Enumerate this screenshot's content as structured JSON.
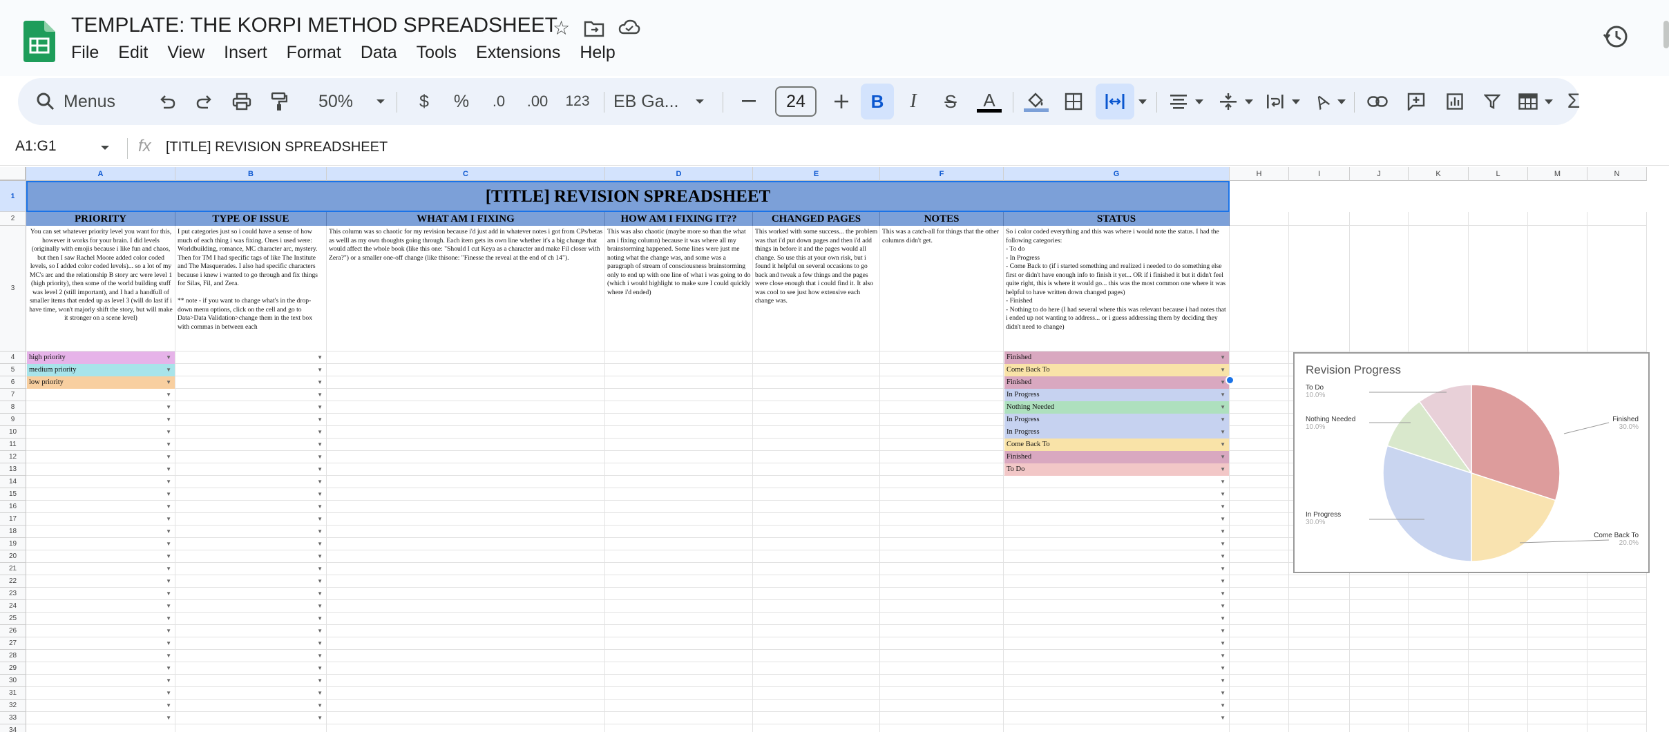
{
  "doc": {
    "title": "TEMPLATE: THE KORPI METHOD SPREADSHEET"
  },
  "menu": [
    "File",
    "Edit",
    "View",
    "Insert",
    "Format",
    "Data",
    "Tools",
    "Extensions",
    "Help"
  ],
  "toolbar": {
    "menus_label": "Menus",
    "zoom": "50%",
    "currency": "$",
    "percent": "%",
    "dec_decrease": ".0",
    "dec_increase": ".00",
    "number_format": "123",
    "font": "EB Ga...",
    "font_size": "24"
  },
  "formula_bar": {
    "range": "A1:G1",
    "fx": "fx",
    "content": "[TITLE] REVISION SPREADSHEET"
  },
  "columns": [
    "A",
    "B",
    "C",
    "D",
    "E",
    "F",
    "G",
    "H",
    "I",
    "J",
    "K",
    "L",
    "M",
    "N"
  ],
  "sheet": {
    "title": "[TITLE] REVISION SPREADSHEET",
    "headers": [
      "PRIORITY",
      "TYPE OF ISSUE",
      "WHAT AM I FIXING",
      "HOW AM I FIXING IT??",
      "CHANGED PAGES",
      "NOTES",
      "STATUS"
    ],
    "descriptions": [
      "You can set whatever priority level you want for this, however it works for your brain. I did levels (originally with emojis because i like fun and chaos, but then I saw Rachel Moore added color coded levels, so I added color coded levels)... so a lot of my MC's arc and the relationship B story arc were level 1 (high priority), then some of the world building stuff was level 2 (still important), and I had a handfull of smaller items that ended up as level 3 (will do last if i have time, won't majorly shift the story, but will make it stronger on a scene level)",
      "I put categories just so i could have a sense of how much of each thing i was fixing. Ones i used were: Worldbuilding, romance, MC character arc, mystery. Then for TM I had specific tags of like The Institute and The Masquerades. I also had specific characters because i knew i wanted to go through and fix things for Silas, Fil, and Zera.\n\n** note - if you want to change what's in the drop-down menu options, click on the cell and go to Data>Data Validation>change them in the text box with commas in between each",
      "This column was so chaotic for my revision because i'd just add in whatever notes i got from CPs/betas as welll as my own thoughts going through. Each item gets its own line whether it's a big change that would affect the whole book (like this one: \"Should I cut Keya as a character and make Fil closer with Zera?\") or a smaller one-off change (like thisone: \"Finesse the reveal at the end of ch 14\").",
      "This was also chaotic (maybe more so than the what am i fixing column) because it was where all my brainstorming happened. Some lines were just me noting what the change was, and some was a paragraph of stream of consciousness brainstorming only to end up with one line of what i was going to do (which i would highlight to make sure I could quickly where i'd ended)",
      "This worked with some success... the problem was that i'd put down pages and then i'd add things in before it and the pages would all change. So use this at your own risk, but i found it helpful on several occasions to go back and tweak a few things and the pages were close enough that i could find it. It also was cool to see just how extensive each change was.",
      "This was a catch-all for things that the other columns didn't get.",
      "So i color coded everything and this was where i would note the status. I had the following categories:\n- To do\n- In Progress\n- Come Back to (if i started something and realized i needed to do something else first or didn't have enough info to finish it yet... OR if i finished it but it didn't feel quite right, this is where it would go... this was the most common one where it was helpful to have written down changed pages)\n- Finished\n- Nothing to do here (I had several where this was relevant because i had notes that i ended up not wanting to address... or i guess addressing them by deciding they didn't need to change)"
    ],
    "priority_values": [
      "high priority",
      "medium priority",
      "low priority"
    ],
    "status_values": [
      "Finished",
      "Come Back To",
      "Finished",
      "In Progress",
      "Nothing Needed",
      "In Progress",
      "In Progress",
      "Come Back To",
      "Finished",
      "To Do"
    ]
  },
  "colors": {
    "header_blue": "#7ca0d8",
    "high_priority": "#e6b3e9",
    "medium_priority": "#a8e4ea",
    "low_priority": "#f8cfa0",
    "finished": "#d9a8c0",
    "come_back_to": "#f9e3a8",
    "in_progress": "#c6d2f0",
    "nothing_needed": "#aee0be",
    "to_do": "#f2c7c7"
  },
  "chart_data": {
    "type": "pie",
    "title": "Revision Progress",
    "series": [
      {
        "name": "Finished",
        "value": 30.0,
        "color": "#dd9c9c"
      },
      {
        "name": "Come Back To",
        "value": 20.0,
        "color": "#f9e3b0"
      },
      {
        "name": "In Progress",
        "value": 30.0,
        "color": "#c9d5f0"
      },
      {
        "name": "Nothing Needed",
        "value": 10.0,
        "color": "#d9e8cc"
      },
      {
        "name": "To Do",
        "value": 10.0,
        "color": "#e8d0d8"
      }
    ],
    "labels": [
      "To Do",
      "Nothing Needed",
      "Finished",
      "In Progress",
      "Come Back To"
    ],
    "percent_labels": [
      "10.0%",
      "10.0%",
      "30.0%",
      "30.0%",
      "20.0%"
    ]
  }
}
